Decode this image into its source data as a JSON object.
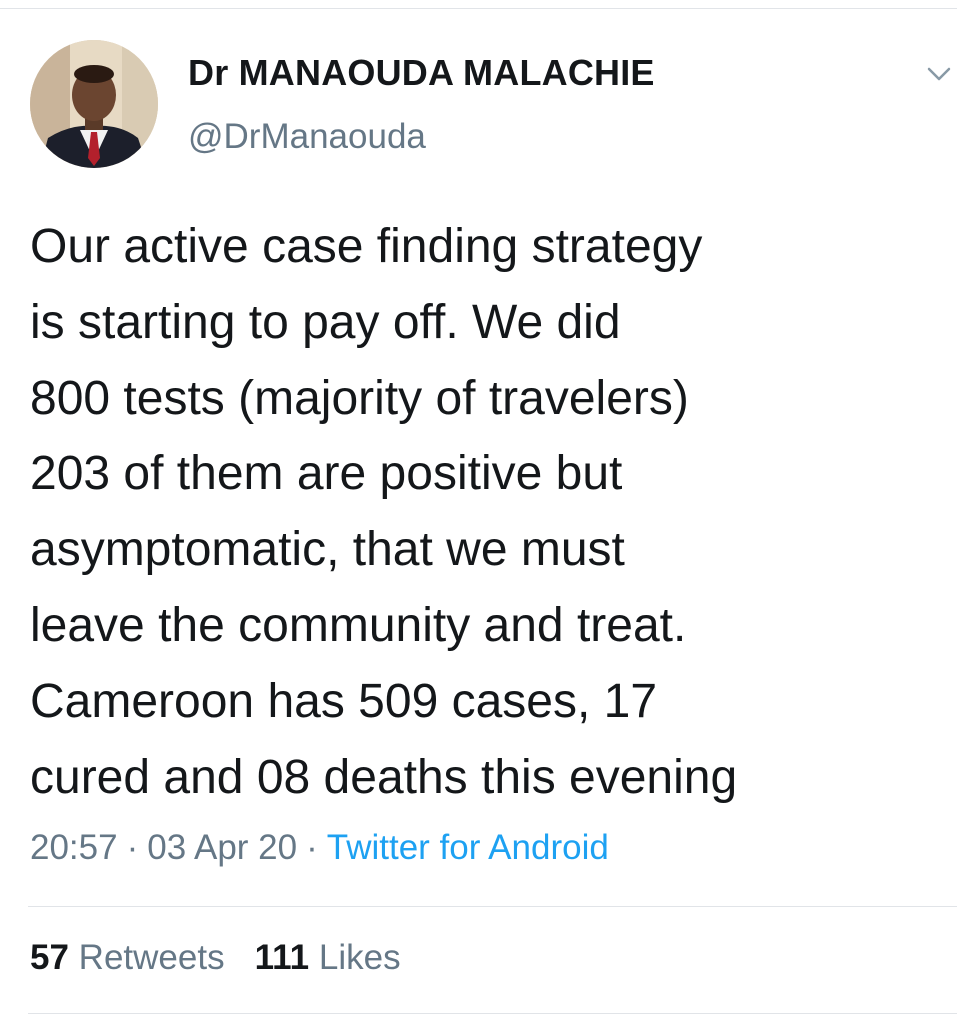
{
  "author": {
    "display_name": "Dr MANAOUDA MALACHIE",
    "handle": "@DrManaouda"
  },
  "tweet": {
    "lines": [
      "Our active case finding strategy",
      "is starting to pay off. We did",
      "800 tests (majority of travelers)",
      "203 of them are positive but",
      "asymptomatic, that we must",
      "leave the community and treat.",
      "Cameroon has 509 cases, 17",
      "cured and 08 deaths this evening"
    ]
  },
  "meta": {
    "time": "20:57",
    "separator": "·",
    "date": "03 Apr 20",
    "source": "Twitter for Android"
  },
  "stats": {
    "retweets_count": "57",
    "retweets_label": "Retweets",
    "likes_count": "111",
    "likes_label": "Likes"
  },
  "icons": {
    "menu": "chevron-down-icon"
  },
  "colors": {
    "secondary_text": "#657786",
    "link": "#1da1f2",
    "divider": "#e1e4e8"
  }
}
